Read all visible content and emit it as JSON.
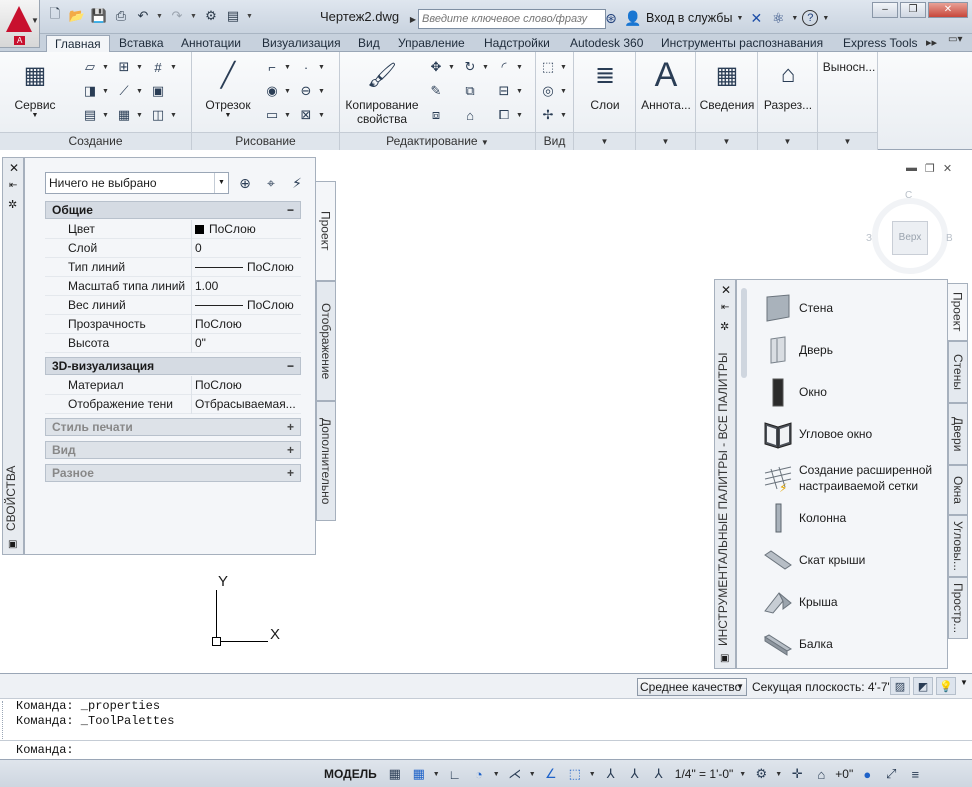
{
  "app": {
    "doc_title": "Чертеж2.dwg",
    "letter": "A"
  },
  "search": {
    "placeholder": "Введите ключевое слово/фразу",
    "signin_label": "Вход в службы"
  },
  "window_controls": {
    "minimize": "‒",
    "restore": "❐",
    "close": "✕"
  },
  "ribbon_tabs": [
    "Главная",
    "Вставка",
    "Аннотации",
    "Визуализация",
    "Вид",
    "Управление",
    "Надстройки",
    "Autodesk 360",
    "Инструменты распознавания",
    "Express Tools"
  ],
  "active_tab": "Главная",
  "panels": {
    "create": {
      "title": "Создание",
      "big_button": "Сервис"
    },
    "draw": {
      "title": "Рисование",
      "big_button": "Отрезок"
    },
    "modify": {
      "title": "Редактирование",
      "big_button_line1": "Копирование",
      "big_button_line2": "свойства"
    },
    "view": {
      "title": "Вид"
    },
    "layers": {
      "big_button": "Слои"
    },
    "annotation": {
      "big_button": "Аннота..."
    },
    "info": {
      "big_button": "Сведения"
    },
    "section": {
      "big_button": "Разрез..."
    },
    "callouts": {
      "big_button": "Выносн..."
    }
  },
  "viewcube": {
    "face": "Верх",
    "north": "С",
    "west": "З",
    "east": "В"
  },
  "ucs": {
    "x_label": "X",
    "y_label": "Y"
  },
  "properties": {
    "palette_title": "СВОЙСТВА",
    "selection": "Ничего не выбрано",
    "tabs": [
      "Проект",
      "Отображение",
      "Дополнительно"
    ],
    "sections": {
      "general": {
        "title": "Общие",
        "sign": "−",
        "rows": [
          {
            "name": "Цвет",
            "value": "ПоСлою"
          },
          {
            "name": "Слой",
            "value": "0"
          },
          {
            "name": "Тип линий",
            "value": "ПоСлою"
          },
          {
            "name": "Масштаб типа линий",
            "value": "1.00"
          },
          {
            "name": "Вес линий",
            "value": "ПоСлою"
          },
          {
            "name": "Прозрачность",
            "value": "ПоСлою"
          },
          {
            "name": "Высота",
            "value": "0\""
          }
        ]
      },
      "viz3d": {
        "title": "3D-визуализация",
        "sign": "−",
        "rows": [
          {
            "name": "Материал",
            "value": "ПоСлою"
          },
          {
            "name": "Отображение тени",
            "value": "Отбрасываемая..."
          }
        ]
      },
      "plotstyle": {
        "title": "Стиль печати",
        "sign": "+"
      },
      "view": {
        "title": "Вид",
        "sign": "+"
      },
      "misc": {
        "title": "Разное",
        "sign": "+"
      }
    }
  },
  "toolpalette": {
    "palette_title": "ИНСТРУМЕНТАЛЬНЫЕ ПАЛИТРЫ - ВСЕ ПАЛИТРЫ",
    "tabs": [
      "Проект",
      "Стены",
      "Двери",
      "Окна",
      "Угловы...",
      "Простр..."
    ],
    "items": [
      {
        "label": "Стена",
        "icon": "wall-icon"
      },
      {
        "label": "Дверь",
        "icon": "door-icon"
      },
      {
        "label": "Окно",
        "icon": "window-icon"
      },
      {
        "label": "Угловое окно",
        "icon": "corner-window-icon"
      },
      {
        "label": "Создание расширенной настраиваемой сетки",
        "icon": "grid-icon"
      },
      {
        "label": "Колонна",
        "icon": "column-icon"
      },
      {
        "label": "Скат крыши",
        "icon": "roof-slab-icon"
      },
      {
        "label": "Крыша",
        "icon": "roof-icon"
      },
      {
        "label": "Балка",
        "icon": "beam-icon"
      }
    ]
  },
  "status_top": {
    "quality": "Среднее качество",
    "section_plane": "Секущая плоскость:  4'-7\""
  },
  "command_history": [
    "Команда: _properties",
    "Команда: _ToolPalettes"
  ],
  "command_prompt": "Команда:",
  "status_bottom": {
    "model": "МОДЕЛЬ",
    "scale": "1/4\" = 1'-0\"",
    "elevation": "+0\""
  },
  "colors": {
    "brand_red": "#c8102e",
    "ribbon_bg": "#e9edf2",
    "palette_bg": "#f4f6f9"
  }
}
